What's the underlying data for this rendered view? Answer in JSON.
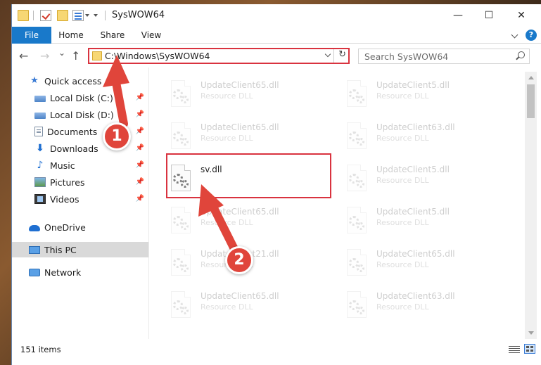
{
  "window": {
    "title": "SysWOW64",
    "minimize_glyph": "—",
    "maximize_glyph": "☐",
    "close_glyph": "✕"
  },
  "ribbon": {
    "tabs": [
      {
        "label": "File"
      },
      {
        "label": "Home"
      },
      {
        "label": "Share"
      },
      {
        "label": "View"
      }
    ],
    "help_glyph": "?"
  },
  "nav": {
    "back_glyph": "←",
    "forward_glyph": "→",
    "recent_glyph": "⌄",
    "up_glyph": "↑",
    "address": "C:\\Windows\\SysWOW64",
    "refresh_glyph": "↻",
    "search_placeholder": "Search SysWOW64"
  },
  "sidebar": {
    "items": [
      {
        "label": "Quick access",
        "icon": "star-icon"
      },
      {
        "label": "Local Disk (C:)",
        "icon": "disk-icon",
        "pinned": true
      },
      {
        "label": "Local Disk (D:)",
        "icon": "disk-icon",
        "pinned": true
      },
      {
        "label": "Documents",
        "icon": "documents-icon",
        "pinned": true
      },
      {
        "label": "Downloads",
        "icon": "downloads-icon",
        "pinned": true
      },
      {
        "label": "Music",
        "icon": "music-icon",
        "pinned": true
      },
      {
        "label": "Pictures",
        "icon": "pictures-icon",
        "pinned": true
      },
      {
        "label": "Videos",
        "icon": "videos-icon",
        "pinned": true
      },
      {
        "label": "OneDrive",
        "icon": "onedrive-icon"
      },
      {
        "label": "This PC",
        "icon": "pc-icon",
        "selected": true
      },
      {
        "label": "Network",
        "icon": "network-icon"
      }
    ],
    "pin_glyph": "📌"
  },
  "files": {
    "left": [
      {
        "name": "UpdateClient65.dll",
        "type": "Resource DLL",
        "faded": true
      },
      {
        "name": "UpdateClient65.dll",
        "type": "Resource DLL",
        "faded": true
      },
      {
        "name": "sv.dll",
        "type": "",
        "faded": false
      },
      {
        "name": "UpdateClient65.dll",
        "type": "Resource DLL",
        "faded": true
      },
      {
        "name": "UpdateClient21.dll",
        "type": "Resource DLL",
        "faded": true
      },
      {
        "name": "UpdateClient65.dll",
        "type": "Resource DLL",
        "faded": true
      }
    ],
    "right": [
      {
        "name": "UpdateClient5.dll",
        "type": "Resource DLL",
        "faded": true
      },
      {
        "name": "UpdateClient63.dll",
        "type": "Resource DLL",
        "faded": true
      },
      {
        "name": "UpdateClient5.dll",
        "type": "Resource DLL",
        "faded": true
      },
      {
        "name": "UpdateClient5.dll",
        "type": "Resource DLL",
        "faded": true
      },
      {
        "name": "UpdateClient65.dll",
        "type": "Resource DLL",
        "faded": true
      },
      {
        "name": "UpdateClient63.dll",
        "type": "Resource DLL",
        "faded": true
      }
    ]
  },
  "status": {
    "item_count": "151 items"
  },
  "annotations": {
    "step1": "1",
    "step2": "2",
    "arrow_color": "#e0453b"
  }
}
